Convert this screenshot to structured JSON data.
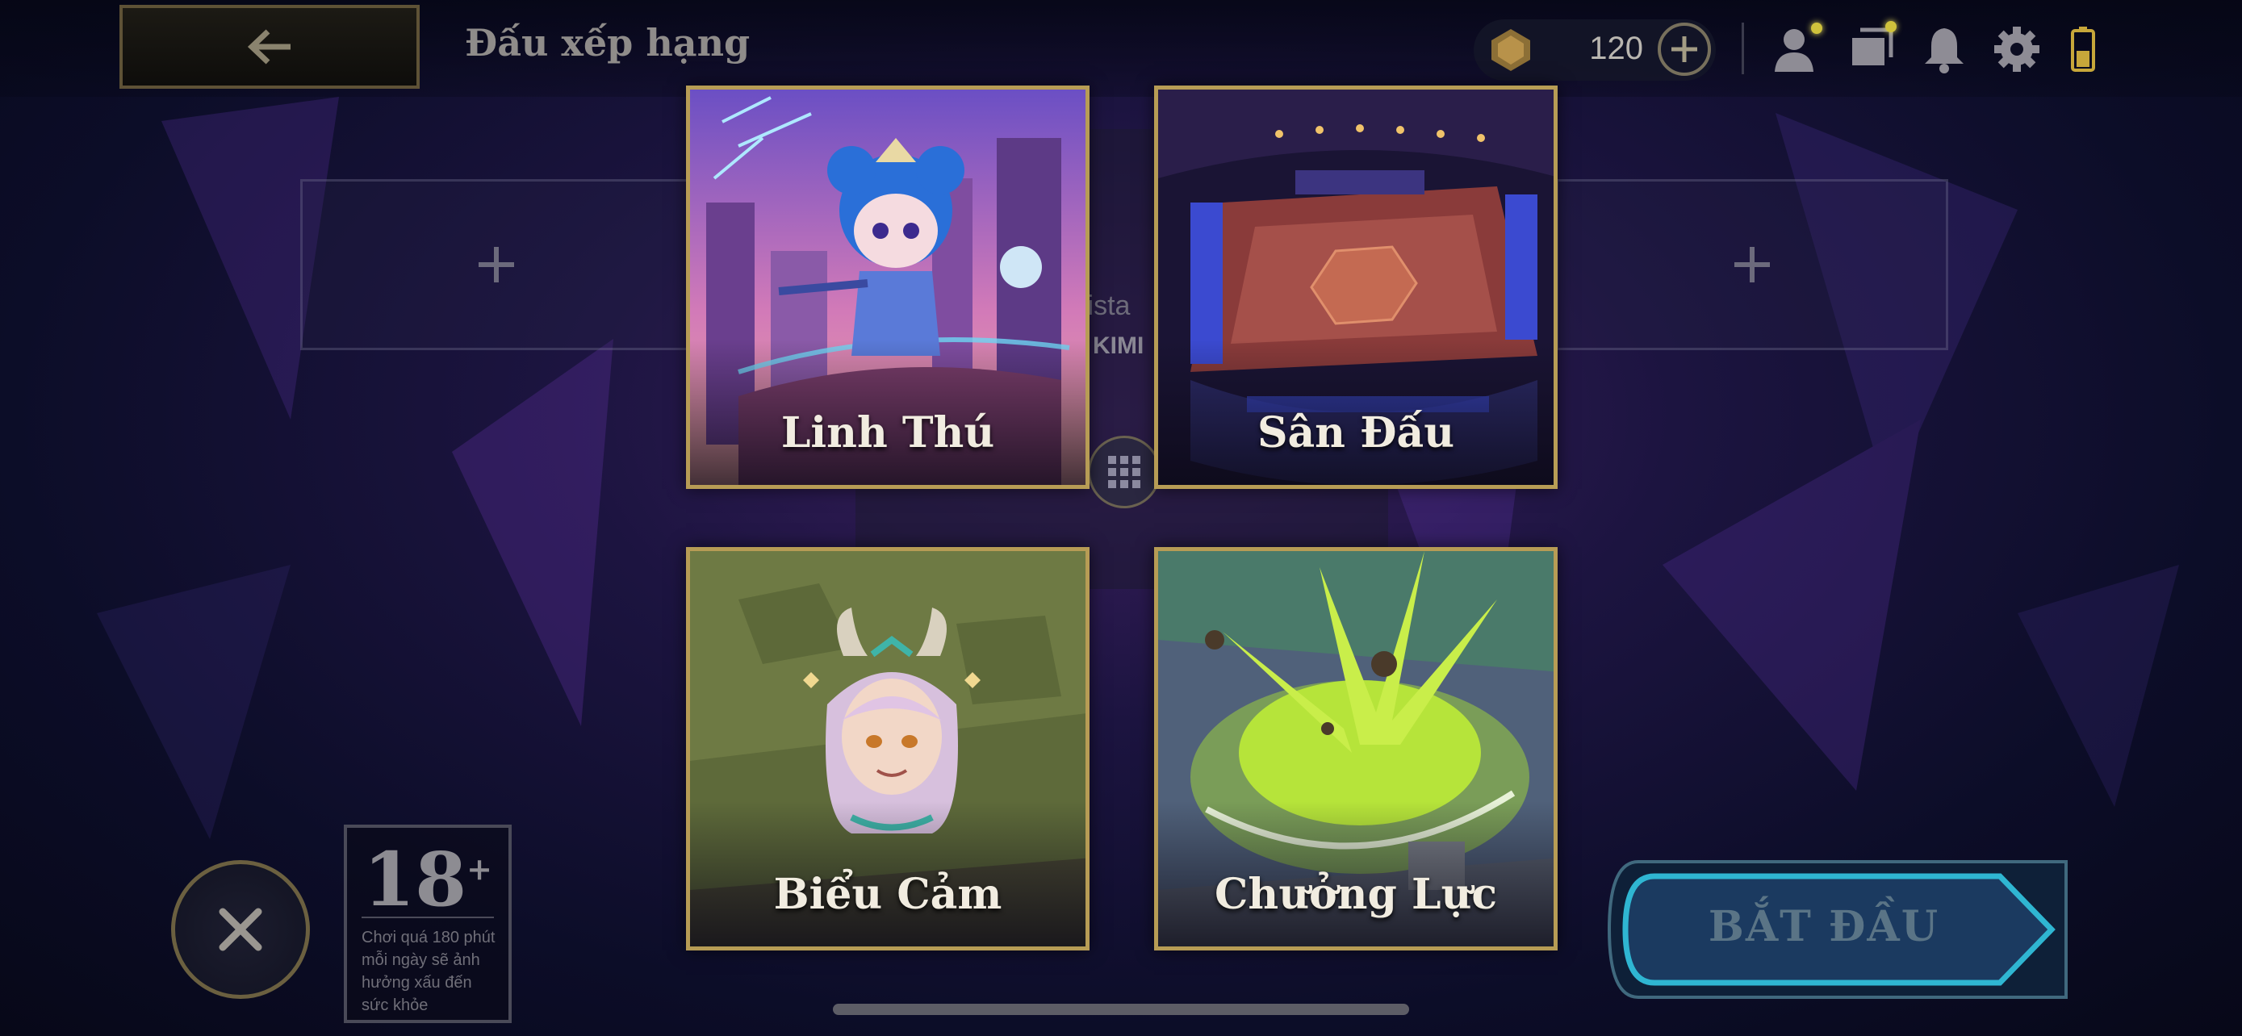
{
  "header": {
    "title": "Đấu xếp hạng",
    "currency_amount": "120"
  },
  "background": {
    "name_fragment": "lista",
    "tag_fragment": "KIMI"
  },
  "tiles": [
    {
      "label": "Linh Thú"
    },
    {
      "label": "Sân Đấu"
    },
    {
      "label": "Biểu Cảm"
    },
    {
      "label": "Chưởng Lực"
    }
  ],
  "age_rating": {
    "rating": "18",
    "plus": "+",
    "warning": "Chơi quá 180 phút mỗi ngày sẽ ảnh hưởng xấu đến sức khỏe"
  },
  "start_button": {
    "label": "BẮT ĐẦU"
  },
  "icons": {
    "back": "back-arrow-icon",
    "currency": "gem-icon",
    "add_currency": "plus-icon",
    "profile": "profile-icon",
    "collection": "collection-icon",
    "notifications": "bell-icon",
    "settings": "gear-icon",
    "battery": "battery-icon",
    "close": "close-icon",
    "grid": "grid-icon"
  },
  "colors": {
    "frame_gold": "#b79c55",
    "start_cyan": "#2fb6d2",
    "notification_dot": "#cfc23c"
  }
}
